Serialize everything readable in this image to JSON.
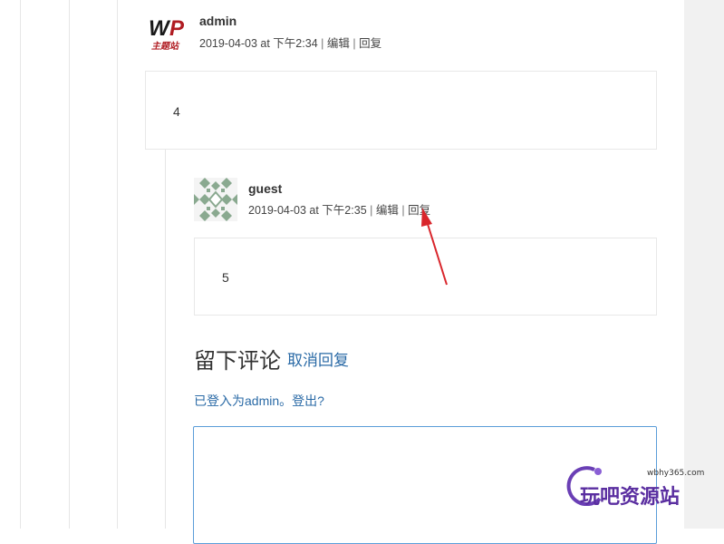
{
  "comments": [
    {
      "author": "admin",
      "avatar_icon": "wp-theme-logo",
      "avatar_text": "主题站",
      "date": "2019-04-03 at 下午2:34",
      "edit_label": "编辑",
      "reply_label": "回复",
      "content": "4"
    },
    {
      "author": "guest",
      "avatar_icon": "identicon",
      "date": "2019-04-03 at 下午2:35",
      "edit_label": "编辑",
      "reply_label": "回复",
      "content": "5"
    }
  ],
  "reply_form": {
    "title": "留下评论",
    "cancel_label": "取消回复",
    "logged_in_prefix": "已登入为admin。",
    "logout_label": "登出?",
    "textarea_value": ""
  },
  "watermark": {
    "domain": "wbhy365.com",
    "text": "玩吧资源站"
  },
  "colors": {
    "link": "#2a6aa6",
    "annotation_arrow": "#d9262c",
    "focus_border": "#5b9dd9"
  }
}
